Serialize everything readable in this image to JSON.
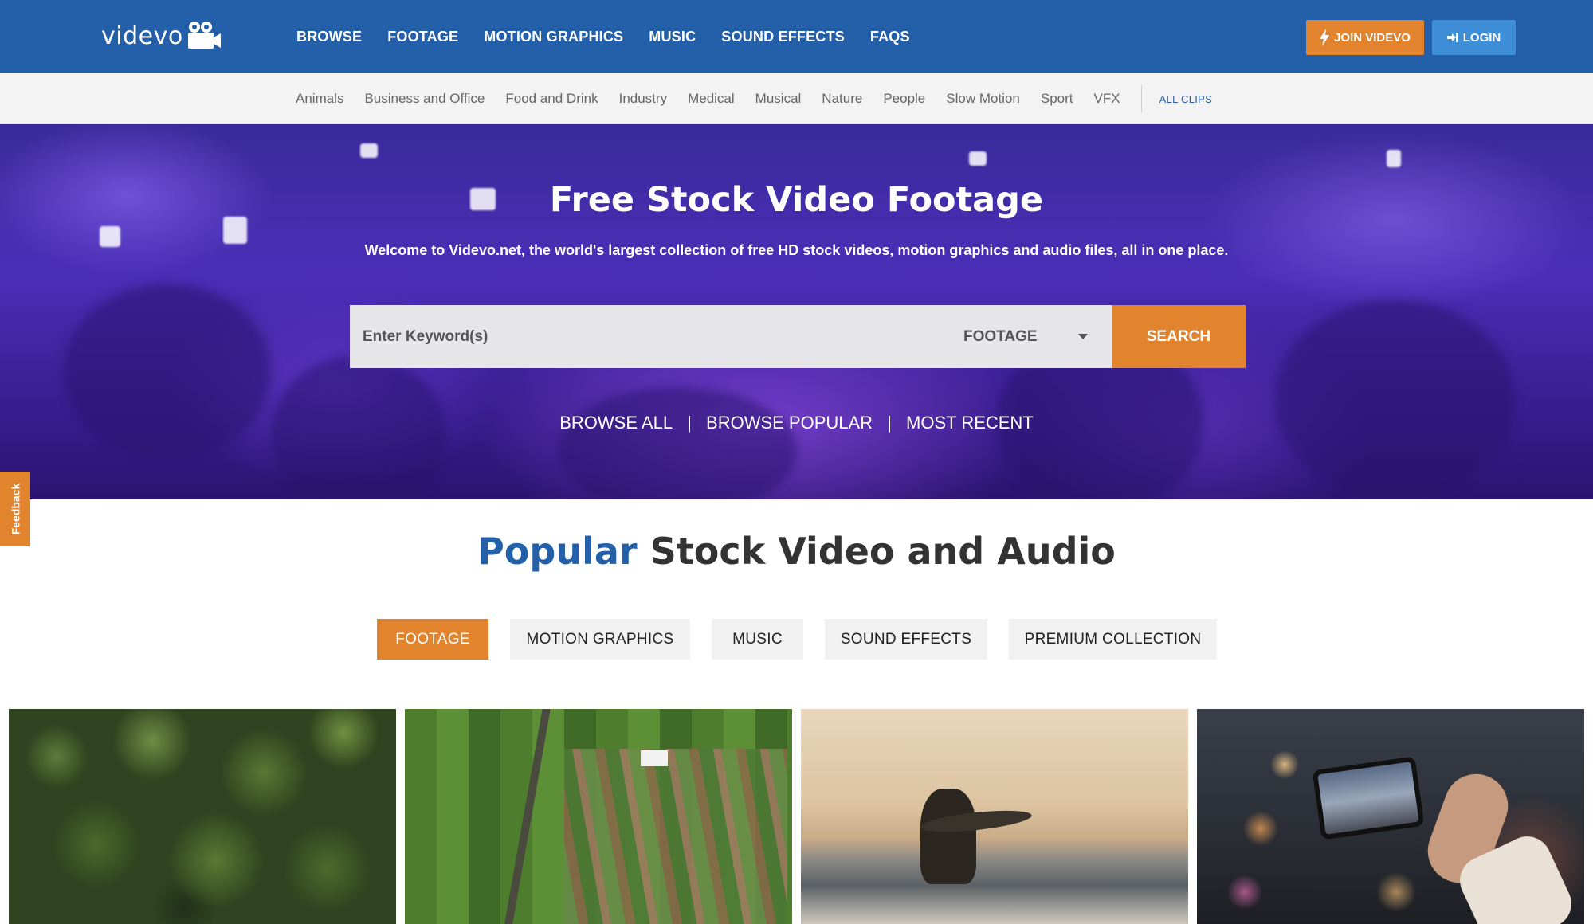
{
  "brand": {
    "name": "videvo"
  },
  "topnav": {
    "items": [
      "BROWSE",
      "FOOTAGE",
      "MOTION GRAPHICS",
      "MUSIC",
      "SOUND EFFECTS",
      "FAQS"
    ],
    "join_label": "JOIN VIDEVO",
    "login_label": "LOGIN"
  },
  "categories": {
    "items": [
      "Animals",
      "Business and Office",
      "Food and Drink",
      "Industry",
      "Medical",
      "Musical",
      "Nature",
      "People",
      "Slow Motion",
      "Sport",
      "VFX"
    ],
    "all_label": "ALL CLIPS"
  },
  "hero": {
    "title": "Free Stock Video Footage",
    "subtitle": "Welcome to Videvo.net, the world's largest collection of free HD stock videos, motion graphics and audio files, all in one place.",
    "search_placeholder": "Enter Keyword(s)",
    "search_type": "FOOTAGE",
    "search_button": "SEARCH",
    "links": [
      "BROWSE ALL",
      "BROWSE POPULAR",
      "MOST RECENT"
    ],
    "link_separator": "|"
  },
  "feedback": {
    "label": "Feedback"
  },
  "popular": {
    "title_highlight": "Popular",
    "title_rest": "Stock Video and Audio",
    "tabs": [
      "FOOTAGE",
      "MOTION GRAPHICS",
      "MUSIC",
      "SOUND EFFECTS",
      "PREMIUM COLLECTION"
    ],
    "active_tab": "FOOTAGE"
  },
  "colors": {
    "primary": "#2360a9",
    "accent": "#e2832d",
    "login": "#3e8ed8",
    "category_bar": "#f3f3f3"
  },
  "icons": {
    "logo": "video-camera-icon",
    "join": "lightning-icon",
    "login": "sign-in-icon",
    "dropdown": "caret-down-icon"
  }
}
